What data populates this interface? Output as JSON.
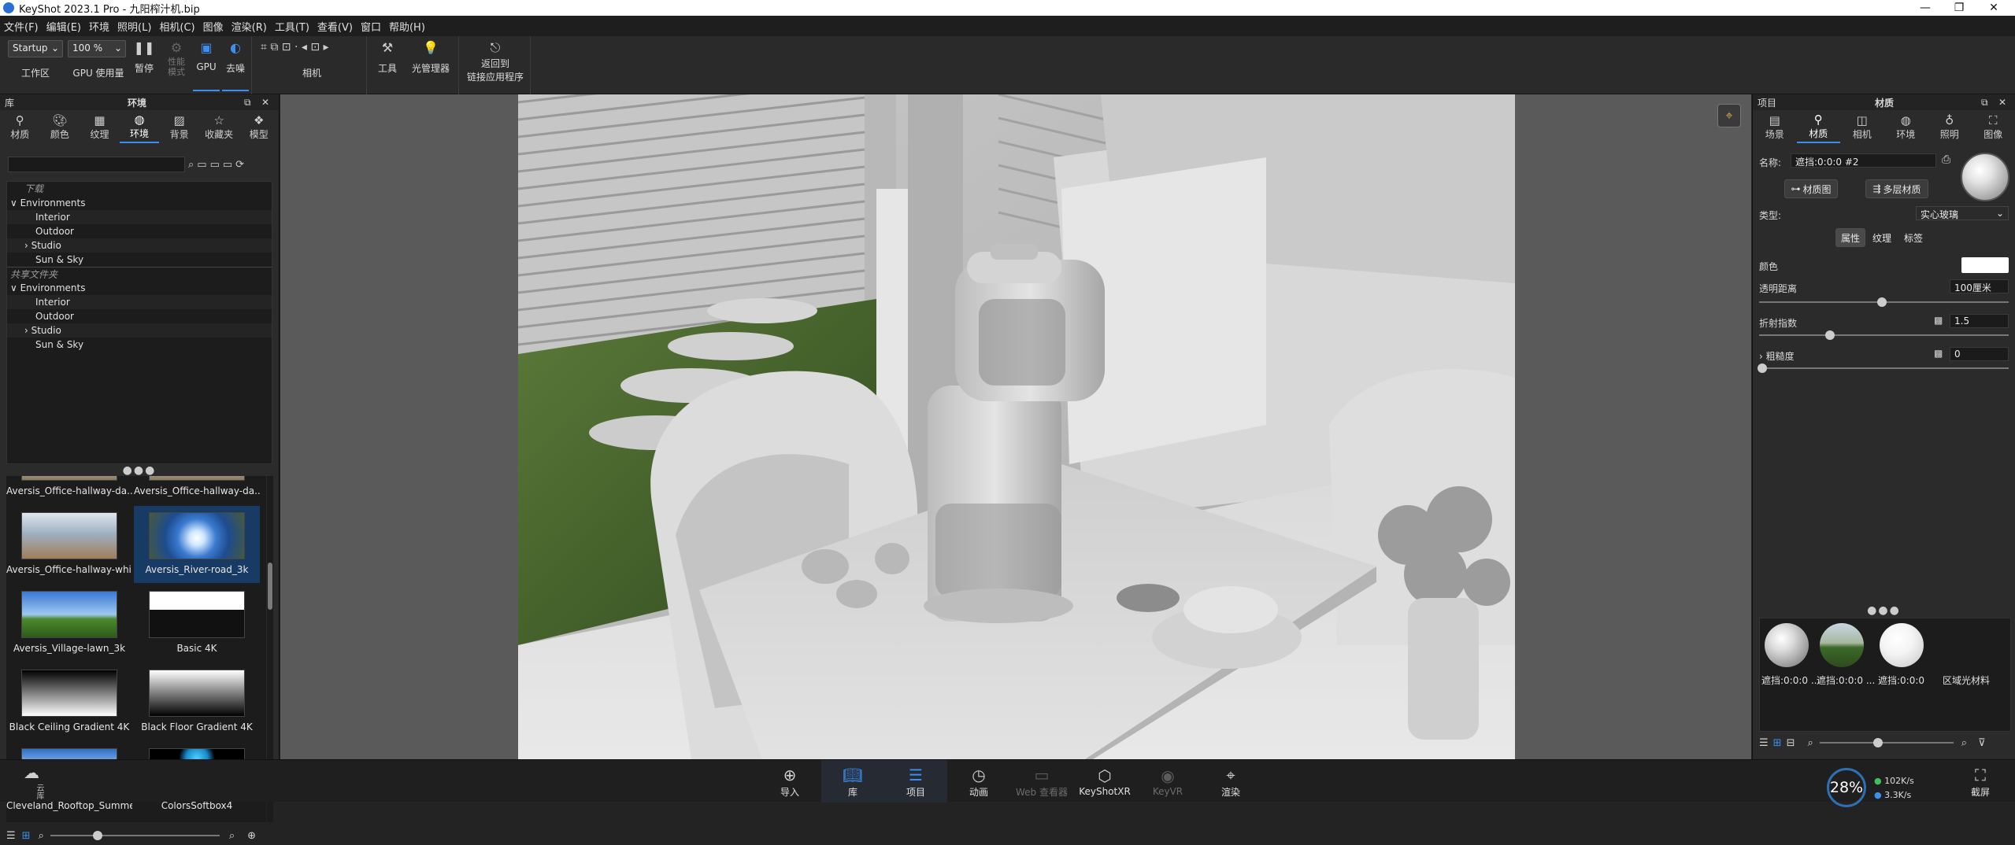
{
  "window": {
    "title": "KeyShot 2023.1 Pro  - 九阳榨汁机.bip",
    "minimize": "—",
    "restore": "❐",
    "close": "✕"
  },
  "menu": [
    "文件(F)",
    "编辑(E)",
    "环境",
    "照明(L)",
    "相机(C)",
    "图像",
    "渲染(R)",
    "工具(T)",
    "查看(V)",
    "窗口",
    "帮助(H)"
  ],
  "ribbon": {
    "workspace_value": "Startup",
    "workspace_label": "工作区",
    "zoom_value": "100 %",
    "gpu_usage_label": "GPU 使用量",
    "pause_label": "暂停",
    "perf_mode_label": "性能\n模式",
    "gpu_label": "GPU",
    "denoise_label": "去噪",
    "camera_label": "相机",
    "tools_label": "工具",
    "light_manager_label": "光管理器",
    "return_label_1": "返回到",
    "return_label_2": "链接应用程序"
  },
  "library": {
    "panel_title": "库",
    "active_tab_title": "环境",
    "tabs": [
      {
        "label": "材质",
        "icon": "material-icon"
      },
      {
        "label": "颜色",
        "icon": "color-icon"
      },
      {
        "label": "纹理",
        "icon": "texture-icon"
      },
      {
        "label": "环境",
        "icon": "environment-icon"
      },
      {
        "label": "背景",
        "icon": "background-icon"
      },
      {
        "label": "收藏夹",
        "icon": "favorites-icon"
      },
      {
        "label": "模型",
        "icon": "model-icon"
      }
    ],
    "tree": [
      {
        "text": "下载",
        "type": "section"
      },
      {
        "text": "∨ Environments",
        "type": "folder"
      },
      {
        "text": "Interior",
        "type": "child"
      },
      {
        "text": "Outdoor",
        "type": "child"
      },
      {
        "text": "›  Studio",
        "type": "child"
      },
      {
        "text": "Sun & Sky",
        "type": "child"
      },
      {
        "text": "共享文件夹",
        "type": "section"
      },
      {
        "text": "∨ Environments",
        "type": "folder"
      },
      {
        "text": "Interior",
        "type": "child"
      },
      {
        "text": "Outdoor",
        "type": "child"
      },
      {
        "text": "›  Studio",
        "type": "child"
      },
      {
        "text": "Sun & Sky",
        "type": "child"
      }
    ],
    "thumbnails": [
      {
        "name": "Aversis_Office-hallway-da...",
        "selected": false
      },
      {
        "name": "Aversis_Office-hallway-da...",
        "selected": false
      },
      {
        "name": "Aversis_Office-hallway-whi...",
        "selected": false
      },
      {
        "name": "Aversis_River-road_3k",
        "selected": true
      },
      {
        "name": "Aversis_Village-lawn_3k",
        "selected": false
      },
      {
        "name": "Basic 4K",
        "selected": false
      },
      {
        "name": "Black Ceiling Gradient 4K",
        "selected": false
      },
      {
        "name": "Black Floor Gradient 4K",
        "selected": false
      },
      {
        "name": "Cleveland_Rooftop_Summer",
        "selected": false
      },
      {
        "name": "ColorsSoftbox4",
        "selected": false
      }
    ]
  },
  "project": {
    "panel_title": "项目",
    "active_tab_title": "材质",
    "tabs": [
      {
        "label": "场景",
        "icon": "scene-icon"
      },
      {
        "label": "材质",
        "icon": "material-icon"
      },
      {
        "label": "相机",
        "icon": "camera-icon"
      },
      {
        "label": "环境",
        "icon": "environment-icon"
      },
      {
        "label": "照明",
        "icon": "lighting-icon"
      },
      {
        "label": "图像",
        "icon": "image-icon"
      }
    ],
    "name_label": "名称:",
    "name_value": "遮挡:0:0:0 #2",
    "material_graph": "材质图",
    "multi_layer": "多层材质",
    "type_label": "类型:",
    "type_value": "实心玻璃",
    "subtabs": [
      "属性",
      "纹理",
      "标签"
    ],
    "props": {
      "color_label": "颜色",
      "transmission_label": "透明距离",
      "transmission_value": "100厘米",
      "ior_label": "折射指数",
      "ior_value": "1.5",
      "roughness_label": "› 粗糙度",
      "roughness_value": "0"
    },
    "materials": [
      {
        "name": "遮挡:0:0:0 ..."
      },
      {
        "name": "遮挡:0:0:0 ..."
      },
      {
        "name": "遮挡:0:0:0"
      },
      {
        "name": "区域光材料"
      }
    ]
  },
  "bottom": {
    "buttons": [
      {
        "label": "导入",
        "icon": "import-icon",
        "state": "normal"
      },
      {
        "label": "库",
        "icon": "library-icon",
        "state": "active"
      },
      {
        "label": "项目",
        "icon": "project-icon",
        "state": "active"
      },
      {
        "label": "动画",
        "icon": "animation-icon",
        "state": "normal"
      },
      {
        "label": "Web 查看器",
        "icon": "web-viewer-icon",
        "state": "dim"
      },
      {
        "label": "KeyShotXR",
        "icon": "keyshotxr-icon",
        "state": "normal"
      },
      {
        "label": "KeyVR",
        "icon": "keyvr-icon",
        "state": "dim"
      },
      {
        "label": "渲染",
        "icon": "render-icon",
        "state": "normal"
      }
    ],
    "cloud_label": "云库",
    "perf_percent": "28%",
    "net_up": "102K/s",
    "net_down": "3.3K/s",
    "screenshot_label": "截屏"
  }
}
